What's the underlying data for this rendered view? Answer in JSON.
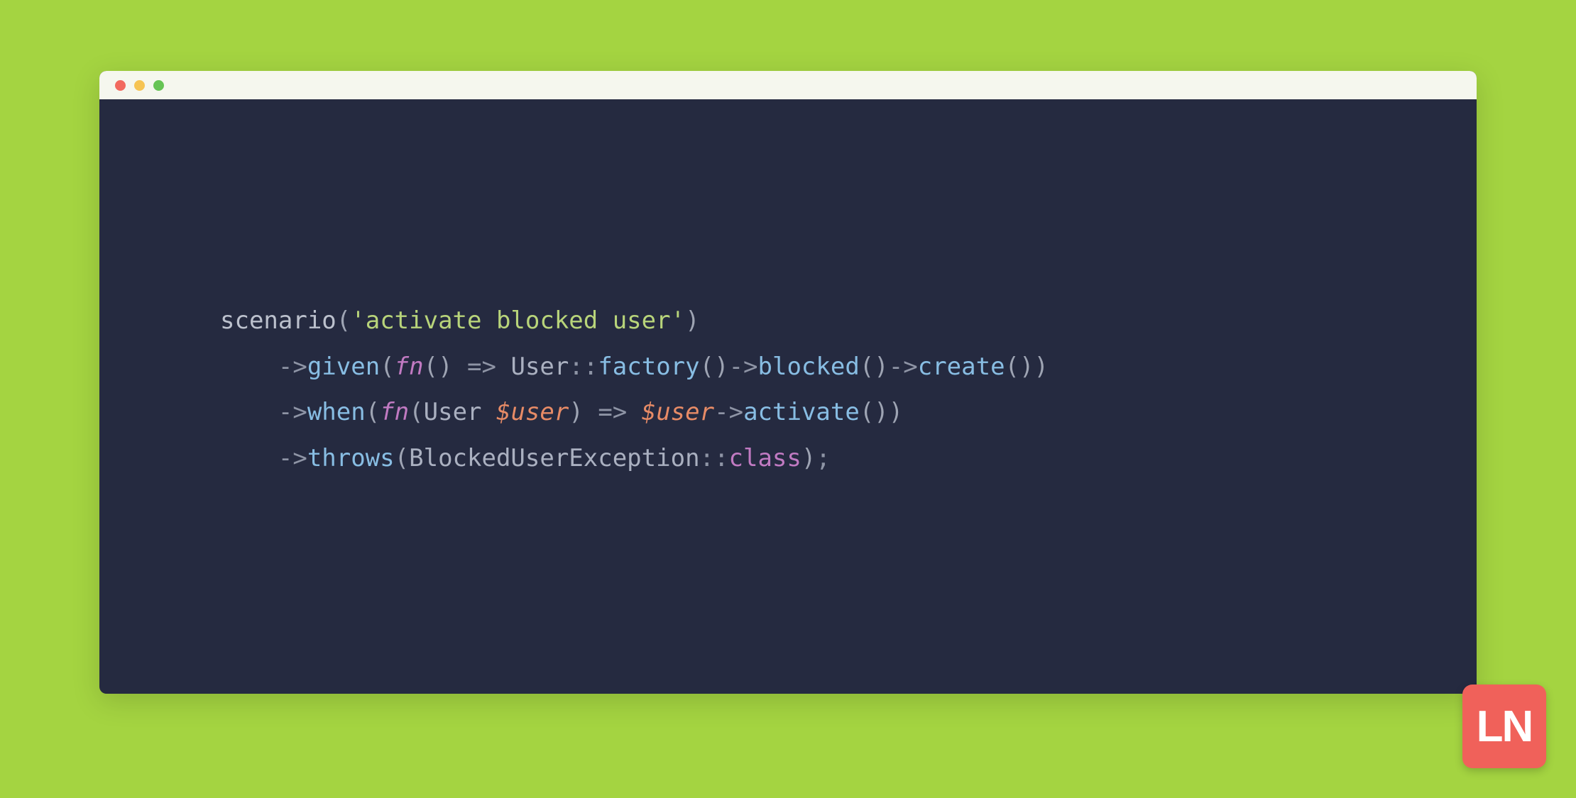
{
  "colors": {
    "background": "#a4d441",
    "editorBg": "#252a40",
    "titleBar": "#f5f7ee",
    "logoBg": "#f0615a"
  },
  "code": {
    "line1": {
      "func": "scenario",
      "open": "(",
      "string": "'activate blocked user'",
      "close": ")"
    },
    "line2": {
      "arrow": "->",
      "method": "given",
      "open": "(",
      "fn": "fn",
      "fnOpen": "()",
      "fatArrow": " => ",
      "type1": "User",
      "dc": "::",
      "m1": "factory",
      "p1": "()",
      "a2": "->",
      "m2": "blocked",
      "p2": "()",
      "a3": "->",
      "m3": "create",
      "p3": "()",
      "close": ")"
    },
    "line3": {
      "arrow": "->",
      "method": "when",
      "open": "(",
      "fn": "fn",
      "fnOpen": "(",
      "type": "User",
      "space": " ",
      "var": "$user",
      "fnClose": ")",
      "fatArrow": " => ",
      "var2": "$user",
      "a2": "->",
      "m2": "activate",
      "p2": "()",
      "close": ")"
    },
    "line4": {
      "arrow": "->",
      "method": "throws",
      "open": "(",
      "type": "BlockedUserException",
      "dc": "::",
      "prop": "class",
      "close": ")",
      "semi": ";"
    }
  },
  "logo": {
    "text": "LN"
  }
}
